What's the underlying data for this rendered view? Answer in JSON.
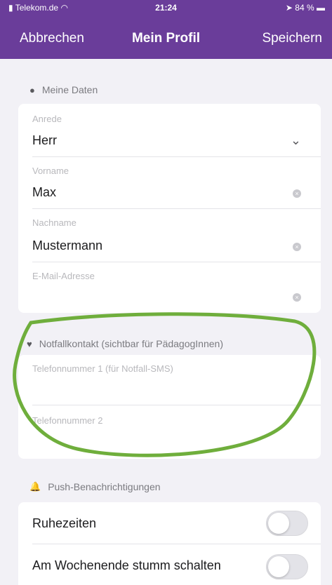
{
  "status_bar": {
    "carrier": "Telekom.de",
    "time": "21:24",
    "battery": "84 %"
  },
  "nav": {
    "cancel": "Abbrechen",
    "title": "Mein Profil",
    "save": "Speichern"
  },
  "section_data": {
    "title": "Meine Daten",
    "fields": {
      "salutation": {
        "label": "Anrede",
        "value": "Herr"
      },
      "first_name": {
        "label": "Vorname",
        "value": "Max"
      },
      "last_name": {
        "label": "Nachname",
        "value": "Mustermann"
      },
      "email": {
        "label": "E-Mail-Adresse",
        "value": ""
      }
    }
  },
  "section_emergency": {
    "title": "Notfallkontakt (sichtbar für PädagogInnen)",
    "phone1": {
      "label": "Telefonnummer 1 (für Notfall-SMS)",
      "value": ""
    },
    "phone2": {
      "label": "Telefonnummer 2",
      "value": ""
    }
  },
  "section_push": {
    "title": "Push-Benachrichtigungen",
    "rows": {
      "quiet": {
        "label": "Ruhezeiten",
        "on": false
      },
      "weekend": {
        "label": "Am Wochenende stumm schalten",
        "on": false
      }
    }
  },
  "colors": {
    "header": "#6a3d9a",
    "annotation": "#6fae3c",
    "background": "#f2f1f6"
  },
  "icons": {
    "person": "person-icon",
    "heart": "heart-icon",
    "bell": "bell-icon",
    "chevron": "chevron-down-icon",
    "clear": "clear-icon"
  }
}
